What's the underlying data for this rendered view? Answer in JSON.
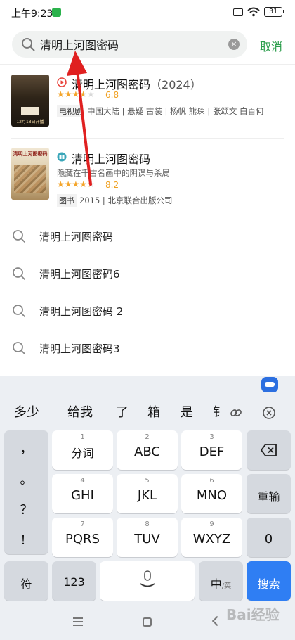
{
  "status_bar": {
    "time": "上午9:23",
    "battery": "31"
  },
  "search": {
    "query": "清明上河图密码",
    "clear_symbol": "×",
    "cancel_label": "取消"
  },
  "results": [
    {
      "type_icon": "play-icon",
      "title": "清明上河图密码",
      "year": "（2024）",
      "rating": 6.8,
      "rating_text": "6.8",
      "stars_filled": 3.5,
      "category_tag": "电视剧",
      "meta": "中国大陆 | 悬疑 古装 | 杨帆 熊琛 | 张颂文 白百何",
      "poster_caption": "12月18日开播",
      "accent": "#e8413a"
    },
    {
      "type_icon": "book-icon",
      "title": "清明上河图密码",
      "description": "隐藏在千古名画中的阴谋与杀局",
      "rating": 8.2,
      "rating_text": "8.2",
      "stars_filled": 4.5,
      "category_tag": "图书",
      "meta": "2015 | 北京联合出版公司",
      "poster_caption": "清明上河图密码",
      "accent": "#3aa6b9"
    }
  ],
  "suggestions": [
    "清明上河图密码",
    "清明上河图密码6",
    "清明上河图密码 2",
    "清明上河图密码3"
  ],
  "keyboard": {
    "candidates": [
      "多少",
      "给我",
      "了",
      "箱",
      "是",
      "钅"
    ],
    "punctuation": [
      "，",
      "。",
      "？",
      "！"
    ],
    "rows": [
      [
        {
          "num": "1",
          "label": "分词"
        },
        {
          "num": "2",
          "label": "ABC"
        },
        {
          "num": "3",
          "label": "DEF"
        }
      ],
      [
        {
          "num": "4",
          "label": "GHI"
        },
        {
          "num": "5",
          "label": "JKL"
        },
        {
          "num": "6",
          "label": "MNO"
        }
      ],
      [
        {
          "num": "7",
          "label": "PQRS"
        },
        {
          "num": "8",
          "label": "TUV"
        },
        {
          "num": "9",
          "label": "WXYZ"
        }
      ]
    ],
    "redo_label": "重输",
    "zero_label": "0",
    "symbol_label": "符",
    "num_label": "123",
    "lang_label": "中",
    "lang_sub": "/英",
    "search_label": "搜索",
    "search_color": "#2f7ef3"
  },
  "watermark": "Bai经验",
  "colors": {
    "accent_green": "#2a9d4b",
    "star": "#f4a52b"
  }
}
